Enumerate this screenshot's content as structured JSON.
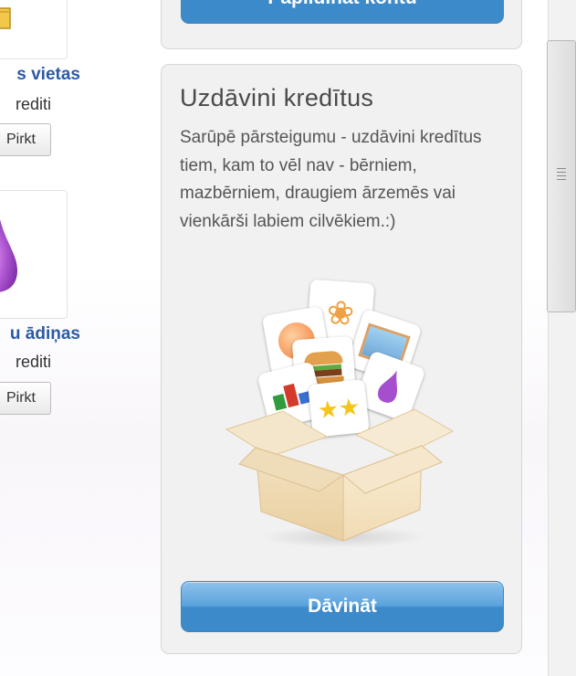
{
  "left_column": {
    "items": [
      {
        "title": "s vietas",
        "price": "rediti",
        "buy_label": "Pirkt",
        "icon": "folder-icon"
      },
      {
        "title": "u ādiņas",
        "price": "rediti",
        "buy_label": "Pirkt",
        "icon": "purple-drop-icon"
      }
    ]
  },
  "top_panel": {
    "button_label": "Papildināt kontu"
  },
  "gift_panel": {
    "title": "Uzdāvini kredītus",
    "description": "Sarūpē pārsteigumu - uzdāvini kredītus tiem, kam to vēl nav - bērniem, mazbērniem, draugiem ārzemēs vai vienkārši labiem cilvēkiem.:)",
    "button_label": "Dāvināt",
    "illustration": "gift-box-with-app-icons"
  },
  "colors": {
    "accent_blue": "#4a97d6",
    "link_blue": "#2b5aa6",
    "panel_bg": "#f1f1f1",
    "purple": "#a54fcf"
  }
}
